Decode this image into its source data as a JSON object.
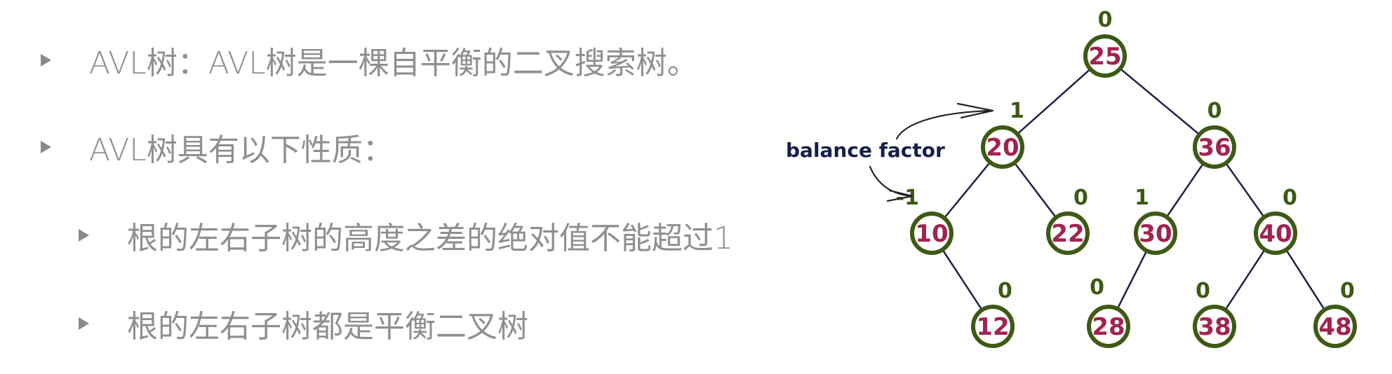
{
  "bullets": [
    {
      "text": "AVL树：AVL树是一棵自平衡的二叉搜索树。",
      "level": 1
    },
    {
      "text": "AVL树具有以下性质：",
      "level": 1
    },
    {
      "text": "根的左右子树的高度之差的绝对值不能超过1",
      "level": 2
    },
    {
      "text": "根的左右子树都是平衡二叉树",
      "level": 2
    }
  ],
  "tree": {
    "annotation": "balance factor",
    "nodes": {
      "n25": {
        "key": "25",
        "bf": "0"
      },
      "n20": {
        "key": "20",
        "bf": "1"
      },
      "n36": {
        "key": "36",
        "bf": "0"
      },
      "n10": {
        "key": "10",
        "bf": "-1"
      },
      "n22": {
        "key": "22",
        "bf": "0"
      },
      "n30": {
        "key": "30",
        "bf": "1"
      },
      "n40": {
        "key": "40",
        "bf": "0"
      },
      "n12": {
        "key": "12",
        "bf": "0"
      },
      "n28": {
        "key": "28",
        "bf": "0"
      },
      "n38": {
        "key": "38",
        "bf": "0"
      },
      "n48": {
        "key": "48",
        "bf": "0"
      }
    },
    "edges": [
      [
        "n25",
        "n20"
      ],
      [
        "n25",
        "n36"
      ],
      [
        "n20",
        "n10"
      ],
      [
        "n20",
        "n22"
      ],
      [
        "n36",
        "n30"
      ],
      [
        "n36",
        "n40"
      ],
      [
        "n10",
        "n12"
      ],
      [
        "n30",
        "n28"
      ],
      [
        "n40",
        "n38"
      ],
      [
        "n40",
        "n48"
      ]
    ]
  },
  "colors": {
    "node_border": "#3d5a14",
    "node_key": "#a3234f",
    "balance_factor": "#3d5a14",
    "edge": "#1c2148",
    "bullet_text": "#8f8f8f"
  }
}
